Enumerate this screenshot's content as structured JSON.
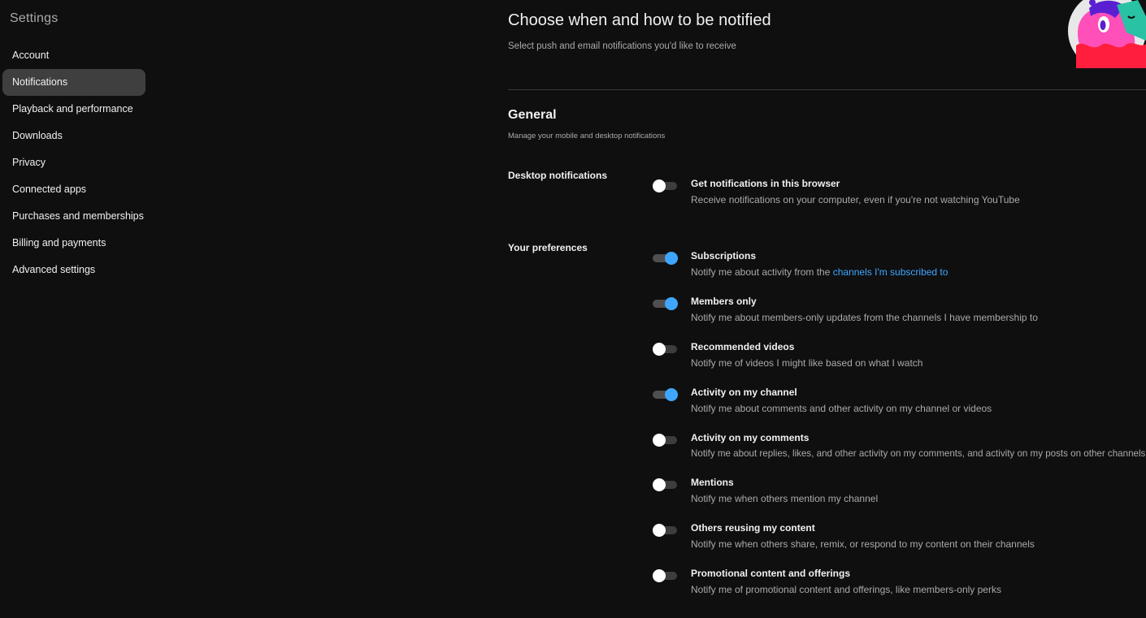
{
  "sidebar": {
    "title": "Settings",
    "items": [
      {
        "label": "Account"
      },
      {
        "label": "Notifications"
      },
      {
        "label": "Playback and performance"
      },
      {
        "label": "Downloads"
      },
      {
        "label": "Privacy"
      },
      {
        "label": "Connected apps"
      },
      {
        "label": "Purchases and memberships"
      },
      {
        "label": "Billing and payments"
      },
      {
        "label": "Advanced settings"
      }
    ],
    "active_item": "Notifications"
  },
  "main": {
    "title": "Choose when and how to be notified",
    "subtitle": "Select push and email notifications you'd like to receive",
    "section": {
      "title": "General",
      "subtitle": "Manage your mobile and desktop notifications"
    },
    "desktop_notifications": {
      "label": "Desktop notifications",
      "setting": {
        "title": "Get notifications in this browser",
        "description": "Receive notifications on your computer, even if you're not watching YouTube",
        "enabled": false
      }
    },
    "preferences": {
      "label": "Your preferences",
      "subscriptions": {
        "title": "Subscriptions",
        "description_prefix": "Notify me about activity from the ",
        "description_link": "channels I'm subscribed to",
        "enabled": true
      },
      "members_only": {
        "title": "Members only",
        "description": "Notify me about members-only updates from the channels I have membership to",
        "enabled": true
      },
      "recommended_videos": {
        "title": "Recommended videos",
        "description": "Notify me of videos I might like based on what I watch",
        "enabled": false
      },
      "activity_channel": {
        "title": "Activity on my channel",
        "description": "Notify me about comments and other activity on my channel or videos",
        "enabled": true
      },
      "activity_comments": {
        "title": "Activity on my comments",
        "description": "Notify me about replies, likes, and other activity on my comments, and activity on my posts on other channels",
        "enabled": false
      },
      "mentions": {
        "title": "Mentions",
        "description": "Notify me when others mention my channel",
        "enabled": false
      },
      "others_reusing": {
        "title": "Others reusing my content",
        "description": "Notify me when others share, remix, or respond to my content on their channels",
        "enabled": false
      },
      "promotional": {
        "title": "Promotional content and offerings",
        "description": "Notify me of promotional content and offerings, like members-only perks",
        "enabled": false
      }
    }
  },
  "colors": {
    "background": "#0f0f0f",
    "accent": "#3ea6ff",
    "text_primary": "#f1f1f1",
    "text_secondary": "#aaaaaa",
    "active_nav": "#3f3f3f"
  },
  "icons": {
    "mascot": "notification-mascot-illustration"
  }
}
